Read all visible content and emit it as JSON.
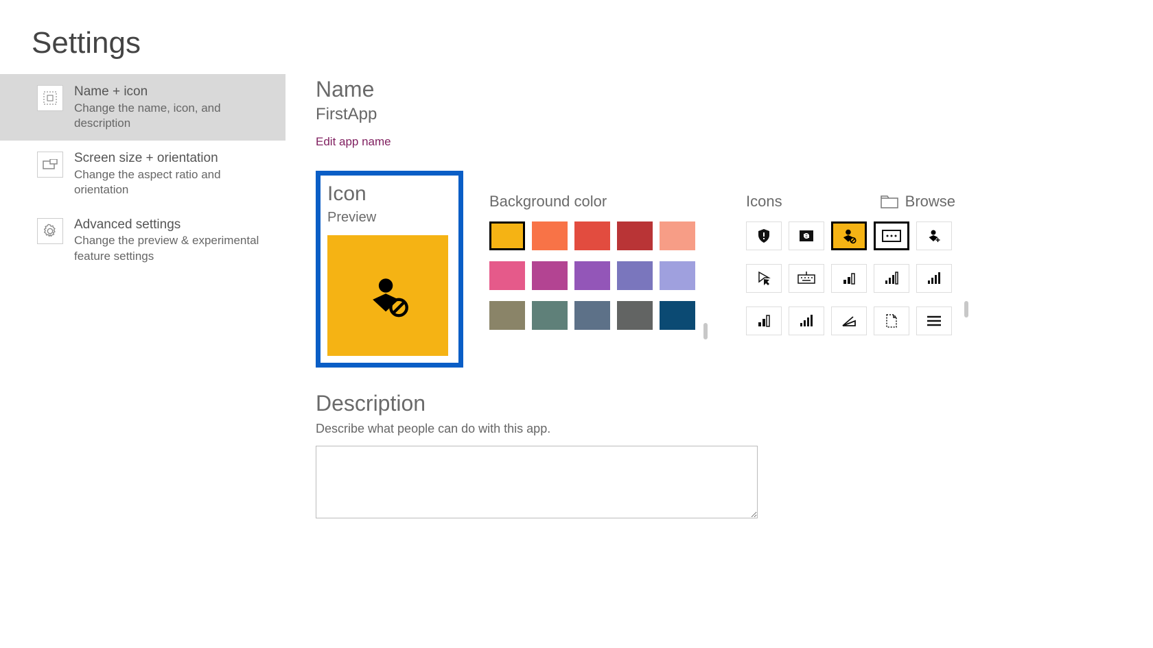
{
  "page_title": "Settings",
  "sidebar": {
    "items": [
      {
        "title": "Name + icon",
        "desc": "Change the name, icon, and description",
        "icon": "grid-icon",
        "selected": true
      },
      {
        "title": "Screen size + orientation",
        "desc": "Change the aspect ratio and orientation",
        "icon": "screen-icon",
        "selected": false
      },
      {
        "title": "Advanced settings",
        "desc": "Change the preview & experimental feature settings",
        "icon": "gear-icon",
        "selected": false
      }
    ]
  },
  "name_section": {
    "heading": "Name",
    "app_name": "FirstApp",
    "edit_link": "Edit app name"
  },
  "icon_section": {
    "heading": "Icon",
    "preview_label": "Preview",
    "preview_bg": "#f5b314",
    "preview_icon": "user-block-icon"
  },
  "bgcolor_section": {
    "heading": "Background color",
    "selected_index": 0,
    "colors": [
      "#f5b314",
      "#f87347",
      "#e24c3f",
      "#b93436",
      "#f79d86",
      "#e55a8a",
      "#b34492",
      "#9356b8",
      "#7a76bd",
      "#9fa0de",
      "#8a8468",
      "#5f8079",
      "#5d7188",
      "#626463",
      "#0b4a73"
    ]
  },
  "icons_section": {
    "heading": "Icons",
    "browse_label": "Browse",
    "selected_index": 2,
    "alt_selected_index": 3,
    "icons": [
      "shield-alert-icon",
      "refresh-card-icon",
      "user-block-icon",
      "card-dots-icon",
      "user-add-icon",
      "pointer-click-icon",
      "keyboard-icon",
      "bars-2-icon",
      "bars-3-icon",
      "bars-4-icon",
      "bars-3b-icon",
      "bars-4b-icon",
      "wedge-icon",
      "page-dashed-icon",
      "menu-lines-icon"
    ]
  },
  "desc_section": {
    "heading": "Description",
    "hint": "Describe what people can do with this app.",
    "value": ""
  }
}
